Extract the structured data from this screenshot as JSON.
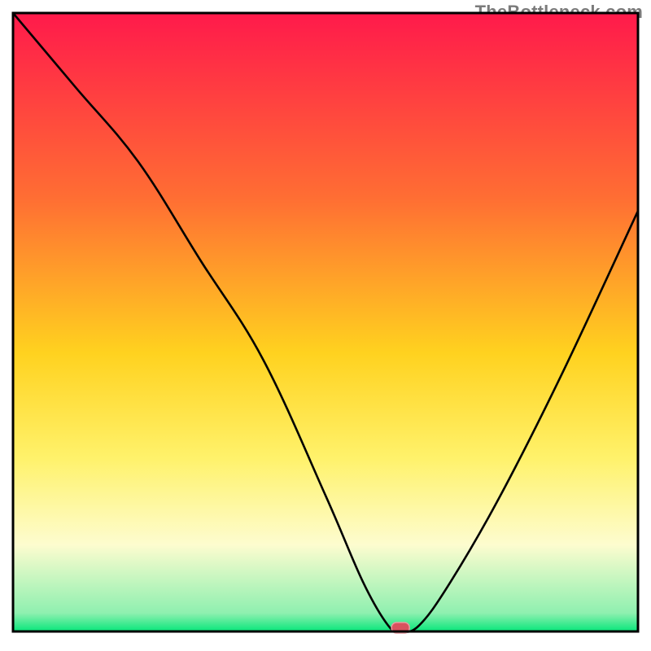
{
  "watermark": "TheBottleneck.com",
  "chart_data": {
    "type": "line",
    "title": "",
    "xlabel": "",
    "ylabel": "",
    "xlim": [
      0,
      100
    ],
    "ylim": [
      0,
      100
    ],
    "optimum_x": 62,
    "colors": {
      "gradient_top": "#ff1a4b",
      "gradient_mid_upper": "#ff6e33",
      "gradient_mid": "#ffd21f",
      "gradient_mid_lower": "#fff26b",
      "gradient_low": "#fdfccf",
      "gradient_bottom": "#07e67a",
      "curve": "#000000",
      "frame": "#000000",
      "marker_fill": "#d9525e",
      "marker_stroke": "#e99aa0"
    },
    "series": [
      {
        "name": "bottleneck-curve",
        "x": [
          0,
          10,
          20,
          30,
          40,
          50,
          56,
          60,
          62,
          65,
          70,
          78,
          88,
          100
        ],
        "values": [
          100,
          88,
          76,
          60,
          44,
          22,
          8,
          1,
          0,
          1,
          8,
          22,
          42,
          68
        ]
      }
    ],
    "marker": {
      "x": 62,
      "y": 0
    },
    "gradient_stops": [
      {
        "offset": 0,
        "color": "#ff1a4b"
      },
      {
        "offset": 0.3,
        "color": "#ff6e33"
      },
      {
        "offset": 0.55,
        "color": "#ffd21f"
      },
      {
        "offset": 0.72,
        "color": "#fff26b"
      },
      {
        "offset": 0.86,
        "color": "#fdfccf"
      },
      {
        "offset": 0.97,
        "color": "#8ff0b0"
      },
      {
        "offset": 1.0,
        "color": "#07e67a"
      }
    ],
    "frame": {
      "x0": 2,
      "y0": 3,
      "x1": 98,
      "y1": 98
    }
  }
}
